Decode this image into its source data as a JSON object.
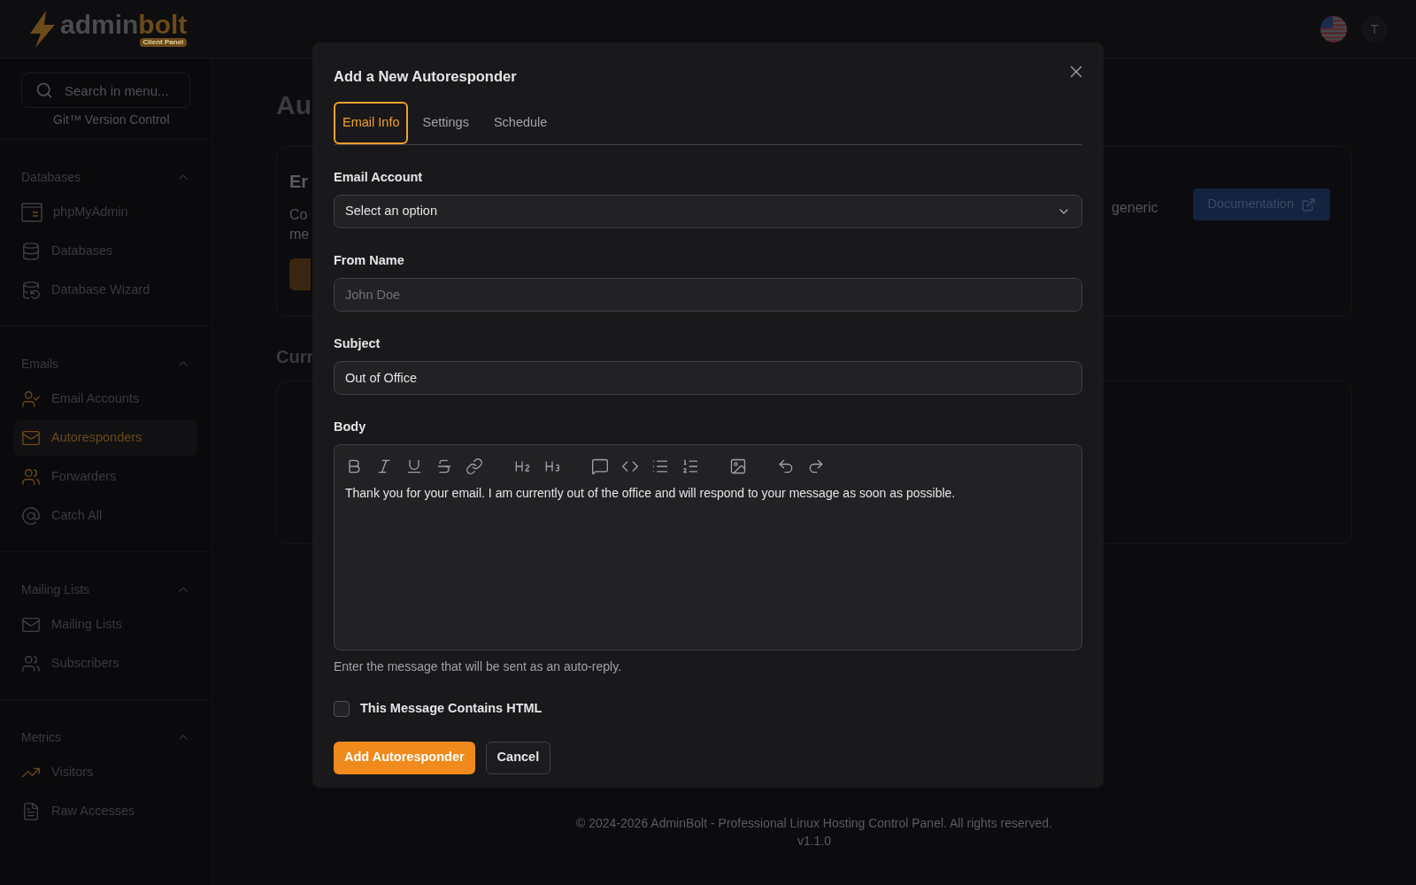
{
  "header": {
    "logo": {
      "main": "admin",
      "accent": "bolt",
      "badge": "Client Panel"
    },
    "avatar": "T"
  },
  "sidebar": {
    "search": {
      "placeholder": "Search in menu..."
    },
    "partial_item": "Git™ Version Control",
    "groups": [
      {
        "title": "Databases",
        "expanded": true,
        "items": [
          {
            "label": "phpMyAdmin",
            "selected": false
          },
          {
            "label": "Databases",
            "selected": false
          },
          {
            "label": "Database Wizard",
            "selected": false
          }
        ]
      },
      {
        "title": "Emails",
        "expanded": true,
        "items": [
          {
            "label": "Email Accounts",
            "selected": false
          },
          {
            "label": "Autoresponders",
            "selected": true
          },
          {
            "label": "Forwarders",
            "selected": false
          },
          {
            "label": "Catch All",
            "selected": false
          }
        ]
      },
      {
        "title": "Mailing Lists",
        "expanded": true,
        "items": [
          {
            "label": "Mailing Lists",
            "selected": false
          },
          {
            "label": "Subscribers",
            "selected": false
          }
        ]
      },
      {
        "title": "Metrics",
        "expanded": true,
        "items": [
          {
            "label": "Visitors",
            "selected": false
          },
          {
            "label": "Raw Accesses",
            "selected": false
          }
        ]
      }
    ]
  },
  "page": {
    "heading": "Au",
    "card": {
      "title": "Er",
      "description_left": [
        "Co",
        "me"
      ],
      "description_right": "generic",
      "documentation_button": "Documentation"
    },
    "section_heading": "Curr",
    "footer": {
      "copyright": "© 2024-2026 AdminBolt - Professional Linux Hosting Control Panel. All rights reserved.",
      "version": "v1.1.0"
    }
  },
  "dialog": {
    "title": "Add a New Autoresponder",
    "tabs": [
      {
        "label": "Email Info",
        "selected": true
      },
      {
        "label": "Settings",
        "selected": false
      },
      {
        "label": "Schedule",
        "selected": false
      }
    ],
    "fields": [
      {
        "kind": "select",
        "label": "Email Account",
        "value": "Select an option"
      },
      {
        "kind": "text",
        "label": "From Name",
        "placeholder": "John Doe"
      },
      {
        "kind": "text",
        "label": "Subject",
        "value": "Out of Office"
      }
    ],
    "body": {
      "label": "Body",
      "text": "Thank you for your email. I am currently out of the office and will respond to your message as soon as possible.",
      "hint": "Enter the message that will be sent as an auto-reply."
    },
    "checkbox": {
      "label": "This Message Contains HTML",
      "checked": false
    },
    "buttons": [
      {
        "label": "Add Autoresponder",
        "kind": "primary"
      },
      {
        "label": "Cancel",
        "kind": "secondary"
      }
    ]
  }
}
